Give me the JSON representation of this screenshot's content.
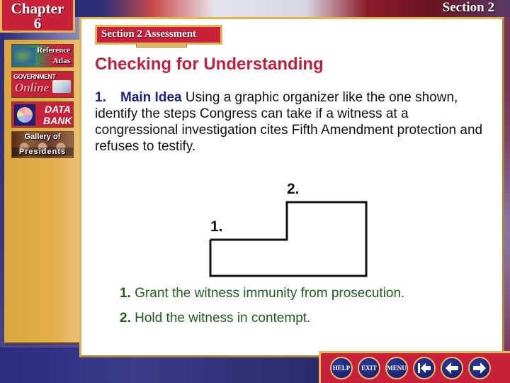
{
  "header": {
    "chapter_word": "Chapter",
    "chapter_number": "6",
    "section_label": "Section 2"
  },
  "sidebar": {
    "items": [
      {
        "label_top": "Reference",
        "label_bottom": "Atlas",
        "icon": "globe-map-icon"
      },
      {
        "label_top": "GOVERNMENT",
        "label_bottom": "Online",
        "icon": "book-mouse-icon"
      },
      {
        "label_top": "DATA",
        "label_bottom": "BANK",
        "icon": "pie-chart-icon"
      },
      {
        "label_top": "Gallery of",
        "label_bottom": "Presidents",
        "icon": "presidents-portrait-icon"
      }
    ]
  },
  "main": {
    "badge": "Section 2 Assessment",
    "heading": "Checking for Understanding",
    "question": {
      "number": "1.",
      "label": "Main Idea",
      "text": "Using a graphic organizer like the one shown, identify the steps Congress can take if a witness at a congressional investigation cites Fifth Amendment protection and refuses to testify."
    },
    "organizer": {
      "step1_label": "1.",
      "step2_label": "2."
    },
    "answers": [
      {
        "number": "1.",
        "text": "Grant the witness immunity from prosecution."
      },
      {
        "number": "2.",
        "text": "Hold the witness in contempt."
      }
    ]
  },
  "nav": {
    "help": "HELP",
    "exit": "EXIT",
    "menu": "MENU",
    "first_icon": "first-page-icon",
    "prev_icon": "previous-arrow-icon",
    "next_icon": "next-arrow-icon"
  },
  "colors": {
    "heading_red": "#c2203f",
    "label_blue": "#1a237e",
    "answer_green": "#1d5e1d",
    "tab_red": "#c8213a",
    "gold": "#e2b04e"
  }
}
